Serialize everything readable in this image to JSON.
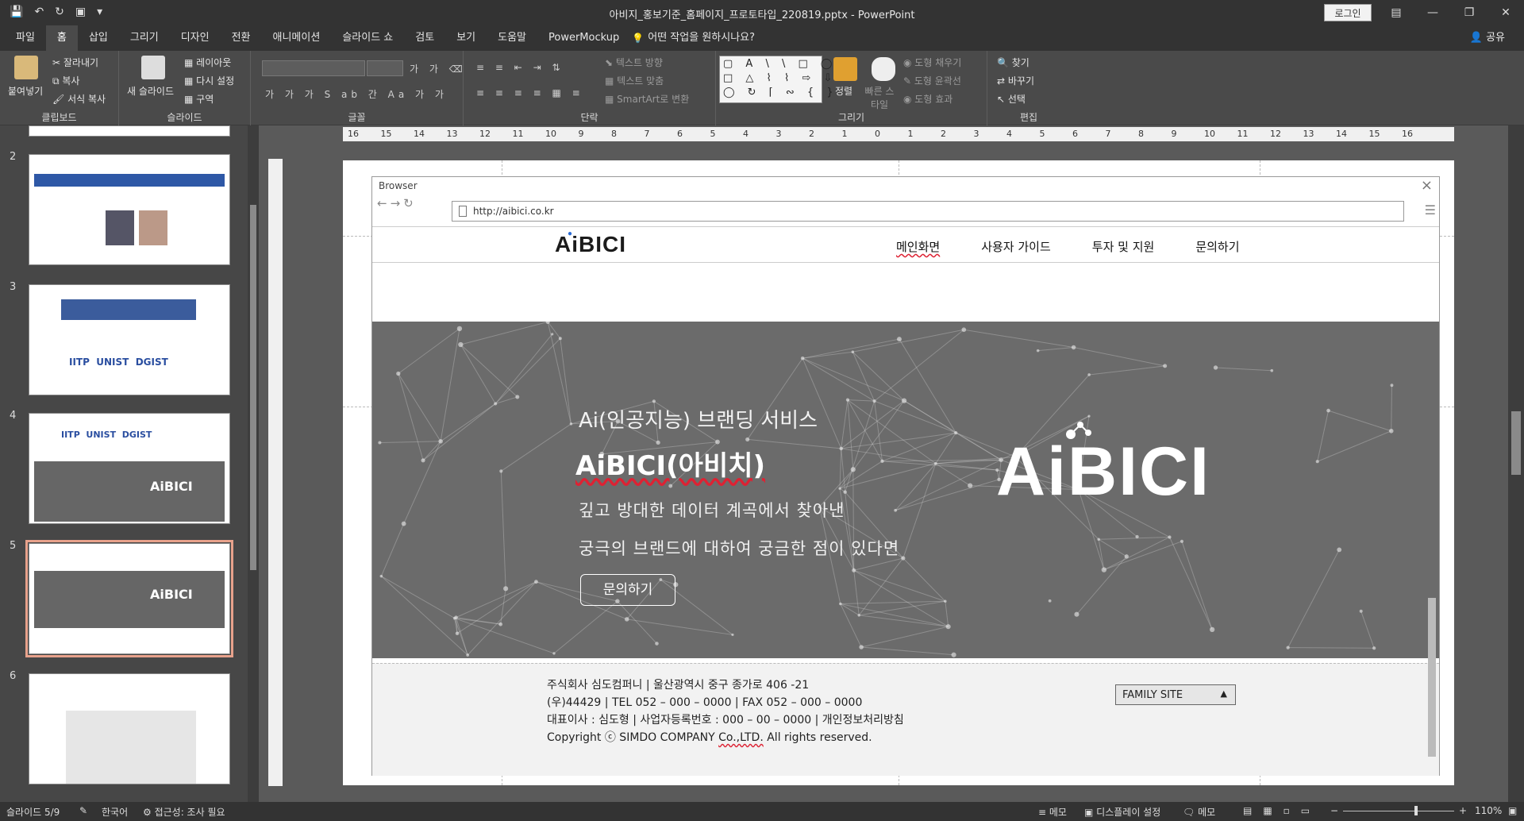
{
  "titlebar": {
    "doc_title": "아비지_홍보기준_홈페이지_프로토타입_220819.pptx  -  PowerPoint",
    "login": "로그인"
  },
  "tabs": [
    "파일",
    "홈",
    "삽입",
    "그리기",
    "디자인",
    "전환",
    "애니메이션",
    "슬라이드 쇼",
    "검토",
    "보기",
    "도움말",
    "PowerMockup"
  ],
  "tellme": "어떤 작업을 원하시나요?",
  "share": "공유",
  "ribbon": {
    "clipboard": {
      "label": "클립보드",
      "paste": "붙여넣기",
      "cut": "잘라내기",
      "copy": "복사",
      "format": "서식 복사"
    },
    "slides": {
      "label": "슬라이드",
      "new": "새 슬라이드",
      "layout": "레이아웃",
      "reset": "다시 설정",
      "section": "구역"
    },
    "font": {
      "label": "글꼴"
    },
    "paragraph": {
      "label": "단락",
      "direction": "텍스트 방향",
      "align": "텍스트 맞춤",
      "smartart": "SmartArt로 변환"
    },
    "drawing": {
      "label": "그리기",
      "arrange": "정렬",
      "quick": "빠른 스타일",
      "fill": "도형 채우기",
      "outline": "도형 윤곽선",
      "effect": "도형 효과"
    },
    "editing": {
      "label": "편집",
      "find": "찾기",
      "replace": "바꾸기",
      "select": "선택"
    }
  },
  "thumbnails": [
    {
      "num": "2"
    },
    {
      "num": "3"
    },
    {
      "num": "4"
    },
    {
      "num": "5"
    },
    {
      "num": "6"
    }
  ],
  "ruler_h": [
    "16",
    "15",
    "14",
    "13",
    "12",
    "11",
    "10",
    "9",
    "8",
    "7",
    "6",
    "5",
    "4",
    "3",
    "2",
    "1",
    "0",
    "1",
    "2",
    "3",
    "4",
    "5",
    "6",
    "7",
    "8",
    "9",
    "10",
    "11",
    "12",
    "13",
    "14",
    "15",
    "16"
  ],
  "browser": {
    "label": "Browser",
    "url": "http://aibici.co.kr"
  },
  "site": {
    "logo": "AiBICI",
    "nav": [
      "메인화면",
      "사용자 가이드",
      "투자 및 지원",
      "문의하기"
    ],
    "hero": {
      "line1": "Ai(인공지능) 브랜딩 서비스",
      "line2": "AiBICI(아비치)",
      "line3": "깊고 방대한 데이터 계곡에서 찾아낸",
      "line4": "궁극의 브랜드에 대하여 궁금한 점이 있다면",
      "cta": "문의하기",
      "logo": "AiBICI"
    },
    "footer": {
      "l1": "주식회사 심도컴퍼니  | 울산광역시 중구 종가로 406 -21",
      "l2": "(우)44429 | TEL 052 – 000 – 0000 | FAX 052 – 000 – 0000",
      "l3": "대표이사 : 심도형 | 사업자등록번호 : 000 – 00 – 0000 | 개인정보처리방침",
      "l4_pre": "Copyright ⓒ SIMDO COMPANY ",
      "l4_co": "Co.,LTD.",
      "l4_post": " All rights reserved.",
      "family": "FAMILY SITE"
    }
  },
  "status": {
    "slide": "슬라이드 5/9",
    "lang": "한국어",
    "access": "접근성: 조사 필요",
    "notes": "메모",
    "display": "디스플레이 설정",
    "comments": "메모",
    "zoom": "110%"
  }
}
